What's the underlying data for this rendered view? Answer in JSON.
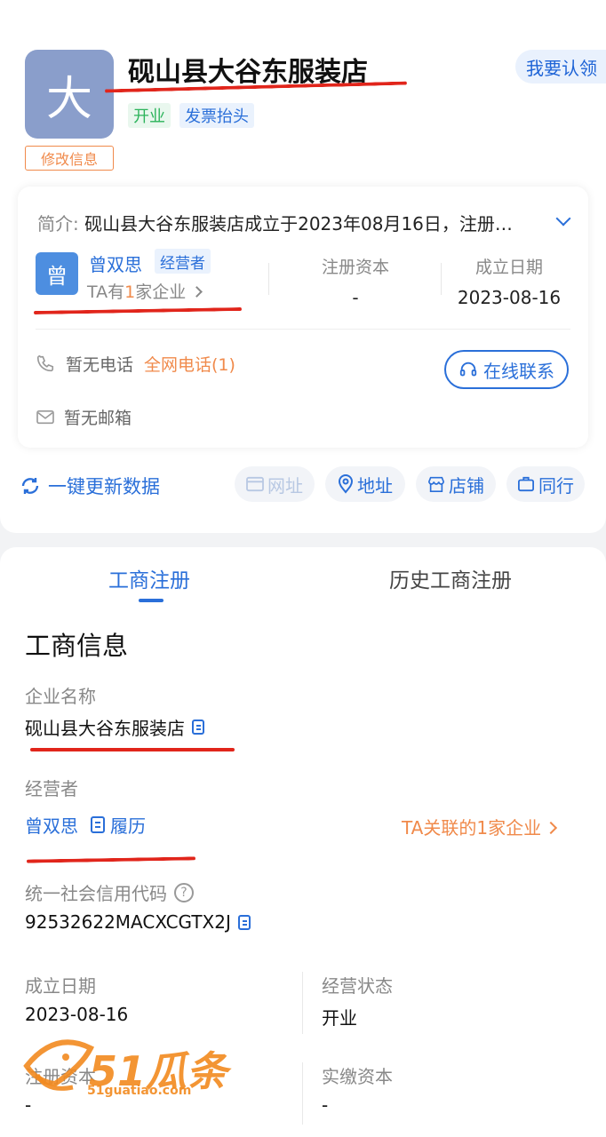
{
  "header": {
    "logo_char": "大",
    "company_name": "砚山县大谷东服装店",
    "claim_label": "我要认领",
    "tags": [
      "开业",
      "发票抬头"
    ],
    "edit_label": "修改信息"
  },
  "summary": {
    "intro_label": "简介:",
    "intro_text": "砚山县大谷东服装店成立于2023年08月16日，注册…",
    "operator": {
      "avatar_char": "曾",
      "name": "曾双思",
      "role": "经营者",
      "companies_prefix": "TA有",
      "companies_count": "1",
      "companies_suffix": "家企业"
    },
    "reg_capital": {
      "label": "注册资本",
      "value": "-"
    },
    "founded": {
      "label": "成立日期",
      "value": "2023-08-16"
    },
    "phone": {
      "text": "暂无电话",
      "link": "全网电话(1)"
    },
    "email": {
      "text": "暂无邮箱"
    },
    "contact_button": "在线联系"
  },
  "actions": {
    "update_label": "一键更新数据",
    "pills": [
      "网址",
      "地址",
      "店铺",
      "同行"
    ]
  },
  "tabs": [
    {
      "label": "工商注册",
      "active": true
    },
    {
      "label": "历史工商注册",
      "active": false
    }
  ],
  "business_info": {
    "section_title": "工商信息",
    "company_name": {
      "label": "企业名称",
      "value": "砚山县大谷东服装店"
    },
    "operator": {
      "label": "经营者",
      "name": "曾双思",
      "resume": "履历",
      "linked": "TA关联的1家企业"
    },
    "credit_code": {
      "label": "统一社会信用代码",
      "value": "92532622MACXCGTX2J"
    },
    "founded": {
      "label": "成立日期",
      "value": "2023-08-16"
    },
    "status": {
      "label": "经营状态",
      "value": "开业"
    },
    "reg_capital": {
      "label": "注册资本",
      "value": "-"
    },
    "paid_capital": {
      "label": "实缴资本",
      "value": "-"
    }
  },
  "watermark": {
    "text": "51瓜条",
    "domain": "51guatiao.com"
  },
  "colors": {
    "primary": "#2a6fd9",
    "accent_orange": "#f08a4b",
    "annotation_red": "#e1251b",
    "open_green": "#2bb35a"
  }
}
